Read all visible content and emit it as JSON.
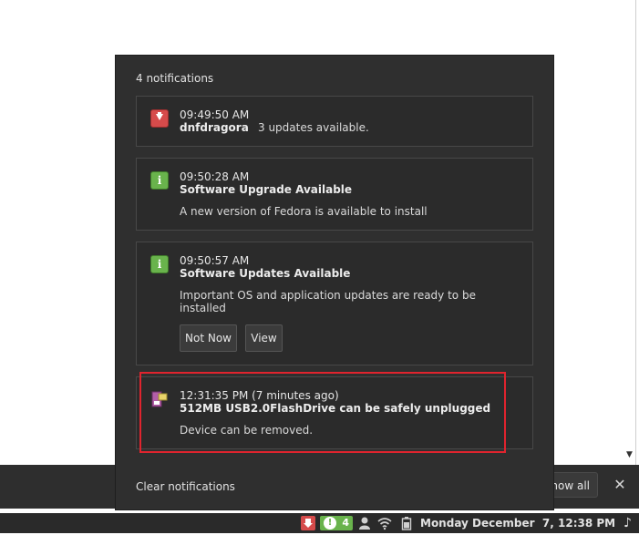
{
  "panel": {
    "header": "4 notifications",
    "clear_label": "Clear notifications"
  },
  "notifications": [
    {
      "time": "09:49:50 AM",
      "app": "dnfdragora",
      "body": "3 updates available.",
      "icon": "download-icon"
    },
    {
      "time": "09:50:28 AM",
      "title": "Software Upgrade Available",
      "body": "A new version of Fedora is available to install",
      "icon": "info-icon"
    },
    {
      "time": "09:50:57 AM",
      "title": "Software Updates Available",
      "body": "Important OS and application updates are ready to be installed",
      "icon": "info-icon",
      "actions": [
        "Not Now",
        "View"
      ]
    },
    {
      "time": "12:31:35 PM (7 minutes ago)",
      "title": "512MB USB2.0FlashDrive can be safely unplugged",
      "body": "Device can be removed.",
      "icon": "usb-drive-icon"
    }
  ],
  "bottom_bar": {
    "show_all_label": "Show all",
    "close_label": "✕"
  },
  "taskbar": {
    "notification_count": "4",
    "datetime": "Monday December  7, 12:38 PM"
  },
  "colors": {
    "panel_bg": "#2f2f2f",
    "highlight": "#e0242e",
    "info_green": "#69b34c",
    "download_red": "#d64b4b"
  }
}
